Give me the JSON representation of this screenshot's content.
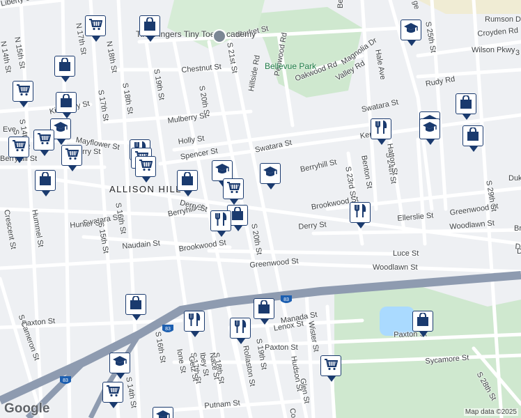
{
  "map": {
    "neighborhood": "ALLISON HILL",
    "park": "Bellevue Park",
    "poi": "Tiny Fingers Tiny Toes Academy",
    "attribution": "Map data ©2025",
    "logo": "Google",
    "highway_shield": "83"
  },
  "colors": {
    "background": "#eef0f3",
    "road": "#ffffff",
    "highway": "#8e9bb0",
    "park": "#c8e6c9",
    "water": "#aadaff",
    "marker_border": "#1a3a6e",
    "marker_icon": "#1a3a6e"
  },
  "streets": [
    {
      "label": "Liberty St"
    },
    {
      "label": "Market St"
    },
    {
      "label": "N 15th St"
    },
    {
      "label": "N 14th St"
    },
    {
      "label": "N 17th St"
    },
    {
      "label": "N 18th St"
    },
    {
      "label": "S 17th St"
    },
    {
      "label": "S 18th St"
    },
    {
      "label": "S 19th St"
    },
    {
      "label": "S 20th St"
    },
    {
      "label": "S 21st St"
    },
    {
      "label": "Chestnut St"
    },
    {
      "label": "Mulberry St"
    },
    {
      "label": "Holly St"
    },
    {
      "label": "Spencer St"
    },
    {
      "label": "Mayflower St"
    },
    {
      "label": "Swatara St"
    },
    {
      "label": "Swatara St"
    },
    {
      "label": "Swatara St"
    },
    {
      "label": "Berryhill St"
    },
    {
      "label": "Berryhill St"
    },
    {
      "label": "Berryhill St"
    },
    {
      "label": "Derry St"
    },
    {
      "label": "Derry St"
    },
    {
      "label": "Derry St"
    },
    {
      "label": "Brookwood St"
    },
    {
      "label": "Brookwood St"
    },
    {
      "label": "Greenwood St"
    },
    {
      "label": "Greenwood St"
    },
    {
      "label": "Woodlawn St"
    },
    {
      "label": "Woodlawn St"
    },
    {
      "label": "Luce St"
    },
    {
      "label": "Ellerslie St"
    },
    {
      "label": "Paxton St"
    },
    {
      "label": "Paxton St"
    },
    {
      "label": "Paxton St"
    },
    {
      "label": "Lenox St"
    },
    {
      "label": "Sycamore St"
    },
    {
      "label": "Putnam St"
    },
    {
      "label": "S Cameron St"
    },
    {
      "label": "S 16th St"
    },
    {
      "label": "S 15th St"
    },
    {
      "label": "S 14th St"
    },
    {
      "label": "S 14th St"
    },
    {
      "label": "Hunter St"
    },
    {
      "label": "Naudain St"
    },
    {
      "label": "Hummel St"
    },
    {
      "label": "Crescent St"
    },
    {
      "label": "Hale Ave"
    },
    {
      "label": "S 25th St"
    },
    {
      "label": "S 24th St"
    },
    {
      "label": "S 23rd St"
    },
    {
      "label": "S 29th St"
    },
    {
      "label": "S 28th St"
    },
    {
      "label": "Benton St"
    },
    {
      "label": "Hatton St"
    },
    {
      "label": "Rumson Dr"
    },
    {
      "label": "Croyden Rd"
    },
    {
      "label": "Wilson Pkwy"
    },
    {
      "label": "Rudy Rd"
    },
    {
      "label": "Oakwood Rd"
    },
    {
      "label": "Valley Rd"
    },
    {
      "label": "Magnolia Dr"
    },
    {
      "label": "Bellevue Rd"
    },
    {
      "label": "Hillside Rd"
    },
    {
      "label": "Penwood Rd"
    },
    {
      "label": "S 19th St"
    },
    {
      "label": "Wister St"
    },
    {
      "label": "Hudson St"
    },
    {
      "label": "Glen St"
    },
    {
      "label": "Rollaston St"
    },
    {
      "label": "S 18th St"
    },
    {
      "label": "Nace St"
    },
    {
      "label": "S 17th St"
    },
    {
      "label": "Ibey St"
    },
    {
      "label": "Getz St"
    },
    {
      "label": "Ione St"
    },
    {
      "label": "Manada St"
    },
    {
      "label": "Ken"
    },
    {
      "label": "S 20th St"
    },
    {
      "label": "Kittatinny St"
    },
    {
      "label": "Duk"
    },
    {
      "label": "Br"
    },
    {
      "label": "D"
    },
    {
      "label": "3"
    },
    {
      "label": "ge"
    },
    {
      "label": "erry St"
    },
    {
      "label": "Eve"
    },
    {
      "label": "Co"
    },
    {
      "label": "S 13"
    },
    {
      "label": "S 16th St"
    }
  ],
  "markers": [
    {
      "type": "grocery",
      "icon": "cart-icon"
    },
    {
      "type": "shopping",
      "icon": "shopping-bag-icon"
    },
    {
      "type": "shopping",
      "icon": "shopping-bag-icon"
    },
    {
      "type": "grocery",
      "icon": "cart-icon"
    },
    {
      "type": "shopping",
      "icon": "shopping-bag-icon"
    },
    {
      "type": "school",
      "icon": "school-icon"
    },
    {
      "type": "grocery",
      "icon": "cart-icon"
    },
    {
      "type": "grocery",
      "icon": "cart-icon"
    },
    {
      "type": "grocery",
      "icon": "cart-icon"
    },
    {
      "type": "shopping",
      "icon": "shopping-bag-icon"
    },
    {
      "type": "restaurant",
      "icon": "fork-knife-icon"
    },
    {
      "type": "grocery",
      "icon": "cart-icon"
    },
    {
      "type": "grocery",
      "icon": "cart-icon"
    },
    {
      "type": "shopping",
      "icon": "shopping-bag-icon"
    },
    {
      "type": "school",
      "icon": "school-icon"
    },
    {
      "type": "school",
      "icon": "school-icon"
    },
    {
      "type": "grocery",
      "icon": "cart-icon"
    },
    {
      "type": "shopping",
      "icon": "shopping-bag-icon"
    },
    {
      "type": "restaurant",
      "icon": "fork-knife-icon"
    },
    {
      "type": "school",
      "icon": "school-icon"
    },
    {
      "type": "restaurant",
      "icon": "fork-knife-icon"
    },
    {
      "type": "restaurant",
      "icon": "fork-knife-icon"
    },
    {
      "type": "school",
      "icon": "school-icon"
    },
    {
      "type": "shopping",
      "icon": "shopping-bag-icon"
    },
    {
      "type": "school",
      "icon": "school-icon"
    },
    {
      "type": "shopping",
      "icon": "shopping-bag-icon"
    },
    {
      "type": "shopping",
      "icon": "shopping-bag-icon"
    },
    {
      "type": "shopping",
      "icon": "shopping-bag-icon"
    },
    {
      "type": "restaurant",
      "icon": "fork-knife-icon"
    },
    {
      "type": "restaurant",
      "icon": "fork-knife-icon"
    },
    {
      "type": "shopping",
      "icon": "shopping-bag-icon"
    },
    {
      "type": "grocery",
      "icon": "cart-icon"
    },
    {
      "type": "school",
      "icon": "school-icon"
    },
    {
      "type": "grocery",
      "icon": "cart-icon"
    },
    {
      "type": "school",
      "icon": "school-icon"
    }
  ]
}
